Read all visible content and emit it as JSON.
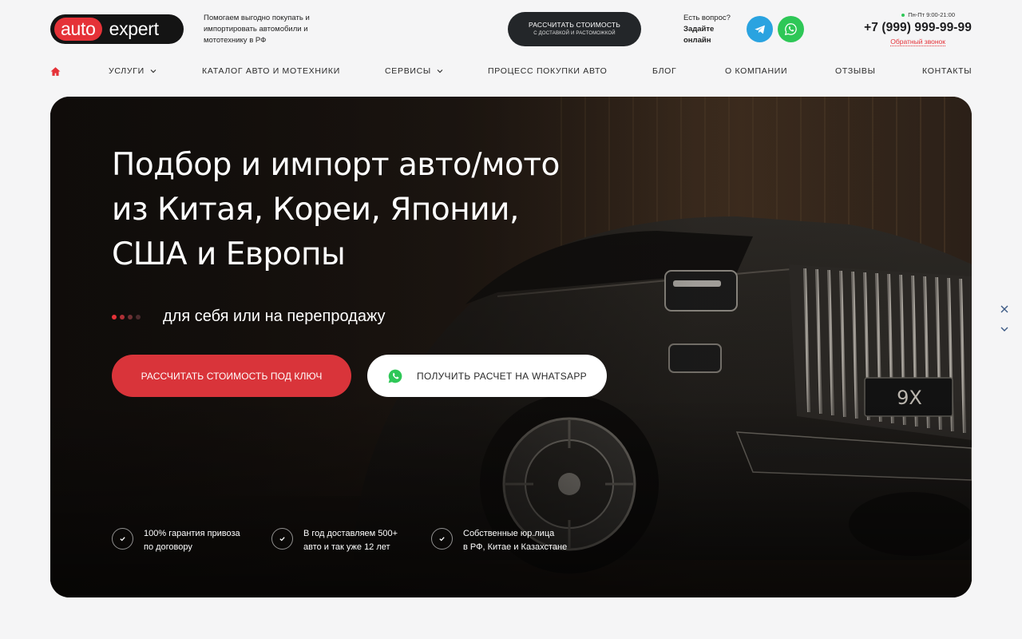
{
  "header": {
    "logo_left": "auto",
    "logo_right": "expert",
    "tagline": "Помогаем выгодно покупать и импортировать автомобили и мототехнику в РФ",
    "calc_button": {
      "main": "РАССЧИТАТЬ СТОИМОСТЬ",
      "sub": "С ДОСТАВКОЙ И РАСТОМОЖКОЙ"
    },
    "question": {
      "line1": "Есть вопрос?",
      "line2": "Задайте",
      "line3": "онлайн"
    },
    "hours": "Пн-Пт 9:00-21:00",
    "phone": "+7 (999) 999-99-99",
    "callback": "Обратный звонок"
  },
  "nav": {
    "items": [
      {
        "label": "УСЛУГИ",
        "dropdown": true
      },
      {
        "label": "КАТАЛОГ АВТО И МОТЕХНИКИ",
        "dropdown": false
      },
      {
        "label": "СЕРВИСЫ",
        "dropdown": true
      },
      {
        "label": "ПРОЦЕСС ПОКУПКИ АВТО",
        "dropdown": false
      },
      {
        "label": "БЛОГ",
        "dropdown": false
      },
      {
        "label": "О КОМПАНИИ",
        "dropdown": false
      },
      {
        "label": "ОТЗЫВЫ",
        "dropdown": false
      },
      {
        "label": "КОНТАКТЫ",
        "dropdown": false
      }
    ]
  },
  "hero": {
    "title_line1": "Подбор и импорт авто/мото",
    "title_line2": "из Китая, Кореи, Японии,",
    "title_line3": "США и Европы",
    "rotator_text": "для себя или на перепродажу",
    "plate_text": "9X",
    "btn_primary": "РАССЧИТАТЬ СТОИМОСТЬ ПОД КЛЮЧ",
    "btn_secondary": "ПОЛУЧИТЬ РАСЧЕТ НА WHATSAPP",
    "features": [
      {
        "line1": "100% гарантия привоза",
        "line2": "по договору"
      },
      {
        "line1": "В год доставляем 500+",
        "line2": "авто и так уже 12 лет"
      },
      {
        "line1": "Собственные юр.лица",
        "line2": "в РФ, Китае и Казахстане"
      }
    ]
  },
  "colors": {
    "accent": "#e53238",
    "dark": "#232629",
    "telegram": "#2aa3e0",
    "whatsapp": "#2ec757"
  }
}
